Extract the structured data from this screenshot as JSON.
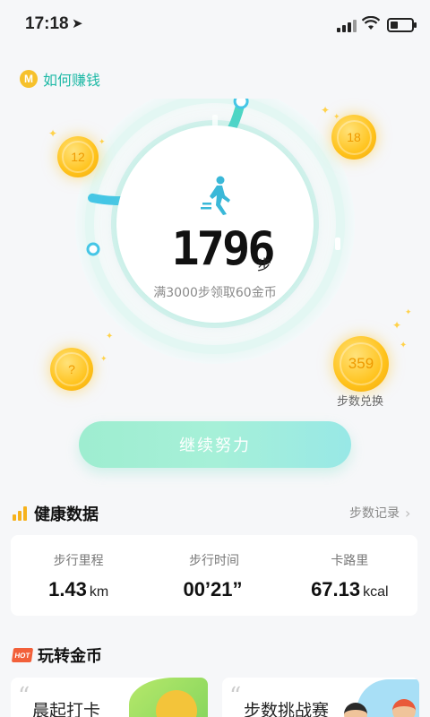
{
  "status_bar": {
    "time": "17:18",
    "location_icon": "➤"
  },
  "earn": {
    "icon_text": "M",
    "label": "如何赚钱"
  },
  "counter": {
    "steps": "1796",
    "unit": "步",
    "hint": "满3000步领取60金币",
    "progress_fraction": 0.6
  },
  "coins": [
    {
      "id": "c12",
      "value": "12"
    },
    {
      "id": "c18",
      "value": "18"
    },
    {
      "id": "cq",
      "value": "?"
    },
    {
      "id": "c359",
      "value": "359"
    }
  ],
  "exchange_label": "步数兑换",
  "continue_button": "继续努力",
  "health": {
    "title": "健康数据",
    "records_link": "步数记录",
    "metrics": [
      {
        "label": "步行里程",
        "value": "1.43",
        "unit": "km"
      },
      {
        "label": "步行时间",
        "value": "00’21”",
        "unit": ""
      },
      {
        "label": "卡路里",
        "value": "67.13",
        "unit": "kcal"
      }
    ]
  },
  "play": {
    "title": "玩转金币",
    "hot_badge": "HOT",
    "cards": [
      {
        "title": "晨起打卡"
      },
      {
        "title": "步数挑战赛"
      }
    ]
  },
  "colors": {
    "accent_teal": "#1fb9a6",
    "coin_gold": "#ffc21a",
    "ring_blue": "#45c6e6"
  }
}
